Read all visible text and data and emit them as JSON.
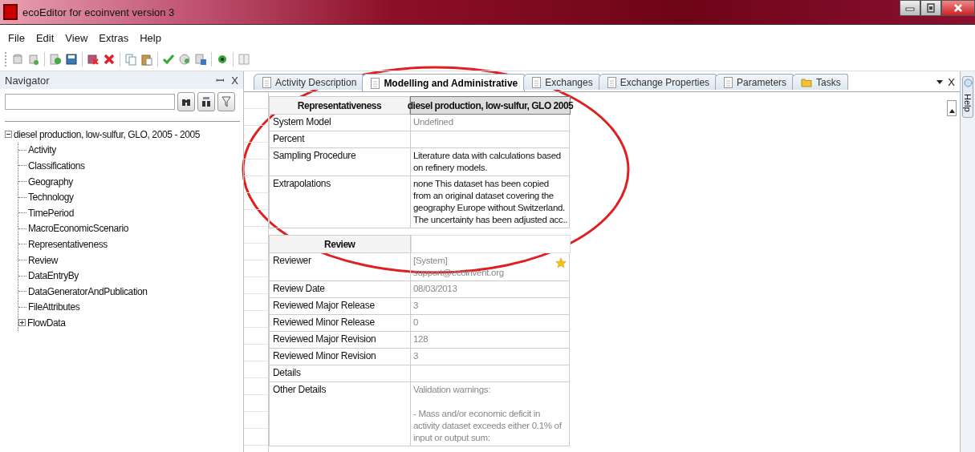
{
  "window": {
    "title": "ecoEditor for ecoinvent version 3"
  },
  "menu": [
    "File",
    "Edit",
    "View",
    "Extras",
    "Help"
  ],
  "navigator": {
    "title": "Navigator",
    "pin": "ꟷ",
    "close": "X",
    "tree": [
      {
        "label": "diesel production, low-sulfur, GLO, 2005 - 2005",
        "expanded": true,
        "children": [
          {
            "label": "Activity"
          },
          {
            "label": "Classifications"
          },
          {
            "label": "Geography"
          },
          {
            "label": "Technology"
          },
          {
            "label": "TimePeriod"
          },
          {
            "label": "MacroEconomicScenario"
          },
          {
            "label": "Representativeness"
          },
          {
            "label": "Review"
          },
          {
            "label": "DataEntryBy"
          },
          {
            "label": "DataGeneratorAndPublication"
          },
          {
            "label": "FileAttributes"
          },
          {
            "label": "FlowData",
            "expanded": false
          }
        ]
      }
    ]
  },
  "tabs": [
    {
      "label": "Activity Description",
      "selected": false,
      "kind": "doc"
    },
    {
      "label": "Modelling and Administrative",
      "selected": true,
      "kind": "doc"
    },
    {
      "label": "Exchanges",
      "selected": false,
      "kind": "doc"
    },
    {
      "label": "Exchange Properties",
      "selected": false,
      "kind": "doc"
    },
    {
      "label": "Parameters",
      "selected": false,
      "kind": "doc"
    },
    {
      "label": "Tasks",
      "selected": false,
      "kind": "folder"
    }
  ],
  "tab_close": "X",
  "side_tab": "Help",
  "sections": [
    {
      "title": "Representativeness",
      "column_2": "diesel production, low-sulfur, GLO 2005",
      "rows": [
        {
          "label": "System Model",
          "value": "Undefined",
          "greyed": true
        },
        {
          "label": "Percent",
          "value": ""
        },
        {
          "label": "Sampling Procedure",
          "value": "Literature data with calculations based\non refinery models.",
          "greyed": false
        },
        {
          "label": "Extrapolations",
          "value": "none This dataset has been copied\nfrom an original dataset covering the\ngeography Europe without Switzerland.\nThe uncertainty has been adjusted acc..",
          "greyed": false
        }
      ]
    },
    {
      "title": "Review",
      "rows": [
        {
          "label": "Reviewer",
          "value": "[System]\nsupport@ecoinvent.org",
          "greyed": true,
          "starred": true
        },
        {
          "label": "Review Date",
          "value": "08/03/2013",
          "greyed": true
        },
        {
          "label": "Reviewed Major Release",
          "value": "3",
          "greyed": true
        },
        {
          "label": "Reviewed Minor Release",
          "value": "0",
          "greyed": true
        },
        {
          "label": "Reviewed Major Revision",
          "value": "128",
          "greyed": true
        },
        {
          "label": "Reviewed Minor Revision",
          "value": "3",
          "greyed": true
        },
        {
          "label": "Details",
          "value": ""
        },
        {
          "label": "Other Details",
          "value": "Validation warnings:\n\n- Mass and/or economic deficit in\nactivity dataset exceeds either 0.1% of\ninput or output sum:",
          "greyed": true
        }
      ]
    }
  ],
  "annotations": [
    {
      "kind": "ellipse",
      "color": "#e02020"
    }
  ]
}
